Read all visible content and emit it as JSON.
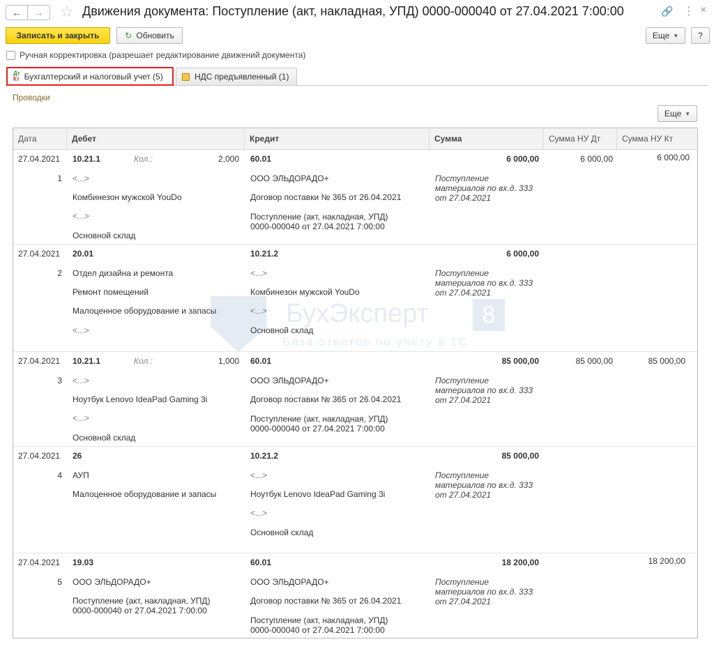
{
  "window": {
    "title": "Движения документа: Поступление (акт, накладная, УПД) 0000-000040 от 27.04.2021 7:00:00"
  },
  "toolbar": {
    "save_close": "Записать и закрыть",
    "refresh": "Обновить",
    "more": "Еще",
    "help": "?"
  },
  "manual_edit": {
    "label": "Ручная корректировка (разрешает редактирование движений документа)"
  },
  "tabs": [
    {
      "label": "Бухгалтерский и налоговый учет (5)",
      "icon_top": "Дт",
      "icon_bottom": "Кт"
    },
    {
      "label": "НДС предъявленный (1)"
    }
  ],
  "section": {
    "label": "Проводки",
    "more": "Еще"
  },
  "table": {
    "headers": {
      "date": "Дата",
      "debit": "Дебет",
      "credit": "Кредит",
      "sum": "Сумма",
      "sum_nu_dt": "Сумма НУ Дт",
      "sum_nu_kt": "Сумма НУ Кт"
    },
    "rows": [
      {
        "date": "27.04.2021",
        "n": "1",
        "dt_account": "10.21.1",
        "qty_label": "Кол.:",
        "qty": "2,000",
        "dt_lines": [
          "<...>",
          "Комбинезон мужской YouDo",
          "<...>",
          "Основной склад"
        ],
        "kt_account": "60.01",
        "kt_lines": [
          "ООО ЭЛЬДОРАДО+",
          "Договор поставки № 365 от 26.04.2021",
          "Поступление (акт, накладная, УПД)",
          "0000-000040 от 27.04.2021 7:00:00"
        ],
        "sum": "6 000,00",
        "content": [
          "Поступление",
          "материалов по вх.д. 333",
          "от 27.04.2021"
        ],
        "nu_dt": "6 000,00",
        "nu_kt": "6 000,00"
      },
      {
        "date": "27.04.2021",
        "n": "2",
        "dt_account": "20.01",
        "dt_lines": [
          "Отдел дизайна и ремонта",
          "Ремонт помещений",
          "Малоценное оборудование и запасы",
          "<...>"
        ],
        "kt_account": "10.21.2",
        "kt_lines": [
          "<...>",
          "Комбинезон мужской YouDo",
          "<...>",
          "Основной склад"
        ],
        "sum": "6 000,00",
        "content": [
          "Поступление",
          "материалов по вх.д. 333",
          "от 27.04.2021"
        ]
      },
      {
        "date": "27.04.2021",
        "n": "3",
        "dt_account": "10.21.1",
        "qty_label": "Кол.:",
        "qty": "1,000",
        "dt_lines": [
          "<...>",
          "Ноутбук Lenovo IdeaPad Gaming 3i",
          "<...>",
          "Основной склад"
        ],
        "kt_account": "60.01",
        "kt_lines": [
          "ООО ЭЛЬДОРАДО+",
          "Договор поставки № 365 от 26.04.2021",
          "Поступление (акт, накладная, УПД)",
          "0000-000040 от 27.04.2021 7:00:00"
        ],
        "sum": "85 000,00",
        "content": [
          "Поступление",
          "материалов по вх.д. 333",
          "от 27.04.2021"
        ],
        "nu_dt": "85 000,00",
        "nu_kt": "85 000,00"
      },
      {
        "date": "27.04.2021",
        "n": "4",
        "dt_account": "26",
        "dt_lines": [
          "АУП",
          "Малоценное оборудование и запасы"
        ],
        "kt_account": "10.21.2",
        "kt_lines": [
          "<...>",
          "Ноутбук Lenovo IdeaPad Gaming 3i",
          "<...>",
          "Основной склад"
        ],
        "sum": "85 000,00",
        "content": [
          "Поступление",
          "материалов по вх.д. 333",
          "от 27.04.2021"
        ]
      },
      {
        "date": "27.04.2021",
        "n": "5",
        "dt_account": "19.03",
        "dt_lines": [
          "ООО ЭЛЬДОРАДО+",
          "Поступление (акт, накладная, УПД)",
          "0000-000040 от 27.04.2021 7:00:00"
        ],
        "kt_account": "60.01",
        "kt_lines": [
          "ООО ЭЛЬДОРАДО+",
          "Договор поставки № 365 от 26.04.2021",
          "Поступление (акт, накладная, УПД)",
          "0000-000040 от 27.04.2021 7:00:00"
        ],
        "sum": "18 200,00",
        "content": [
          "Поступление",
          "материалов по вх.д. 333",
          "от 27.04.2021"
        ],
        "nu_kt": "18 200,00"
      }
    ]
  },
  "watermark": {
    "brand": "БухЭксперт",
    "digit": "8",
    "tagline": "База ответов по учёту в 1С"
  },
  "icons": {
    "back": "arrow-left-icon",
    "forward": "arrow-right-icon",
    "favorite": "star-icon",
    "link": "link-icon",
    "menu": "more-vertical-icon",
    "close": "close-icon",
    "refresh": "refresh-icon"
  }
}
